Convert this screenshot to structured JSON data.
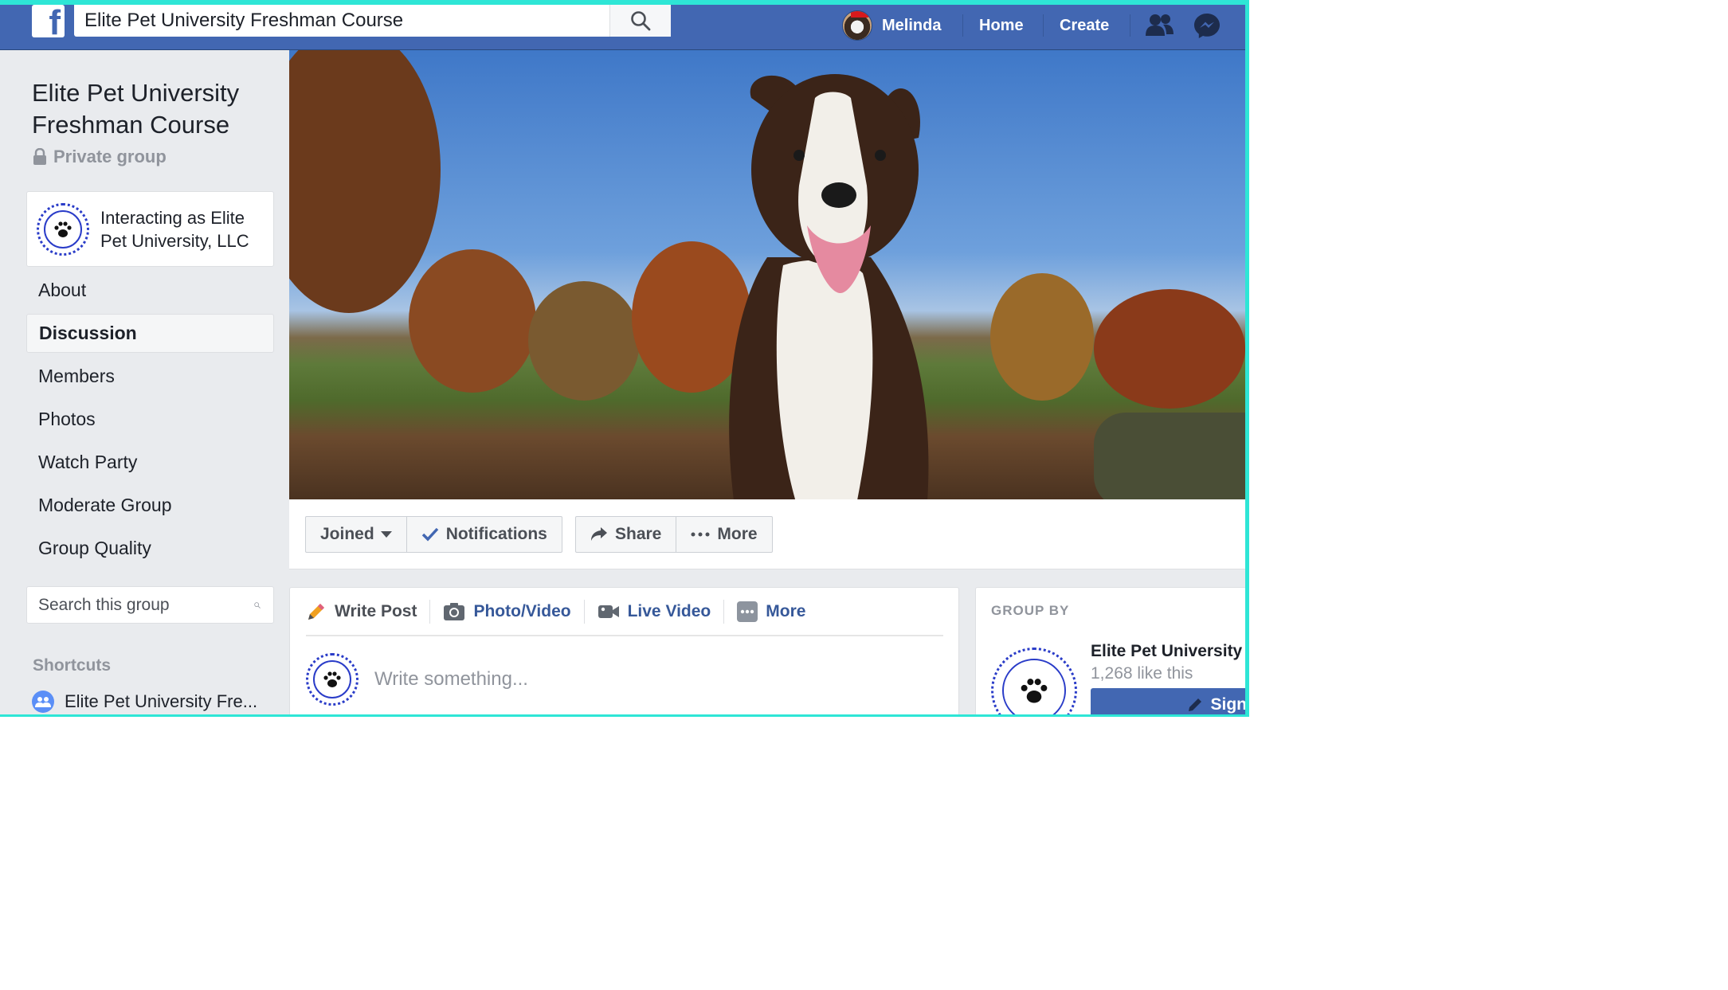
{
  "topbar": {
    "search_value": "Elite Pet University Freshman Course",
    "profile_name": "Melinda",
    "nav_home": "Home",
    "nav_create": "Create",
    "logo_letter": "f"
  },
  "group": {
    "title": "Elite Pet University Freshman Course",
    "privacy": "Private group",
    "interacting_as": "Interacting as Elite Pet University, LLC"
  },
  "sidebar": {
    "items": [
      {
        "label": "About"
      },
      {
        "label": "Discussion"
      },
      {
        "label": "Members"
      },
      {
        "label": "Photos"
      },
      {
        "label": "Watch Party"
      },
      {
        "label": "Moderate Group"
      },
      {
        "label": "Group Quality"
      }
    ],
    "search_placeholder": "Search this group",
    "shortcuts_title": "Shortcuts",
    "shortcut_label": "Elite Pet University Fre..."
  },
  "actions": {
    "joined": "Joined",
    "notifications": "Notifications",
    "share": "Share",
    "more": "More"
  },
  "composer": {
    "write_post": "Write Post",
    "photo_video": "Photo/Video",
    "live_video": "Live Video",
    "more": "More",
    "placeholder": "Write something..."
  },
  "group_by": {
    "title": "GROUP BY",
    "page_name": "Elite Pet University",
    "likes": "1,268 like this",
    "sign_label": "Sign"
  },
  "colors": {
    "brand_blue": "#4267b2",
    "link_blue": "#365899",
    "frame_teal": "#2ee6d6"
  }
}
